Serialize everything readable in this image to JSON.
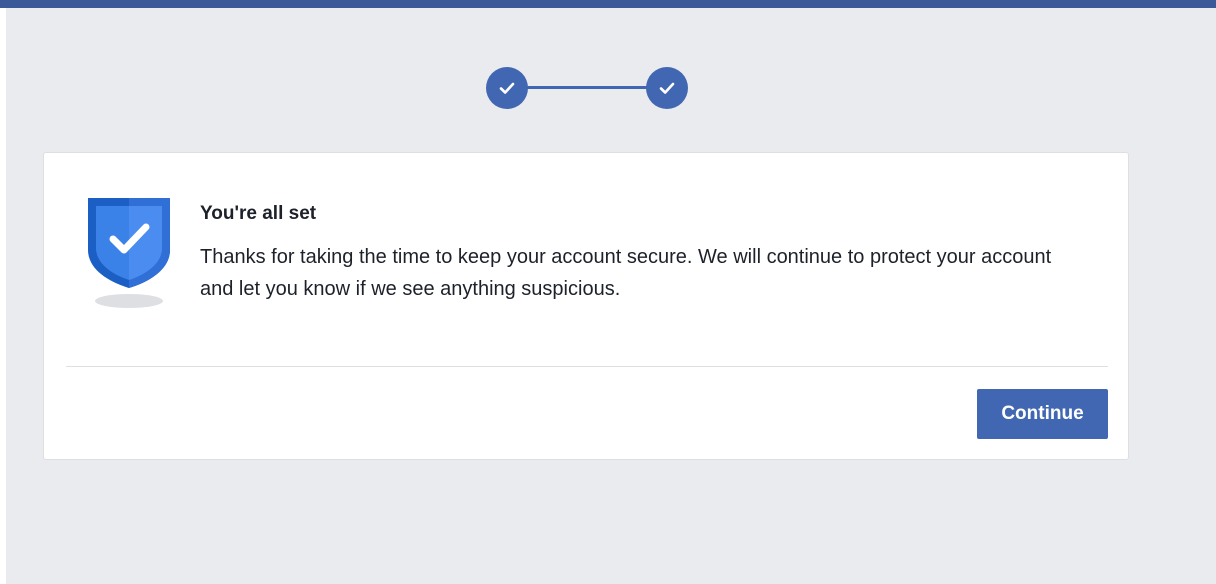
{
  "colors": {
    "top_bar": "#3b5998",
    "background": "#e9ebee",
    "accent": "#4267b2",
    "shield_dark": "#1c5fc4",
    "shield_light": "#3b82e8",
    "text": "#1d2129"
  },
  "stepper": {
    "steps": [
      {
        "status": "complete",
        "icon": "check-icon"
      },
      {
        "status": "complete",
        "icon": "check-icon"
      }
    ]
  },
  "card": {
    "icon": "shield-check-icon",
    "title": "You're all set",
    "body": "Thanks for taking the time to keep your account secure. We will continue to protect your account and let you know if we see anything suspicious.",
    "continue_label": "Continue"
  }
}
